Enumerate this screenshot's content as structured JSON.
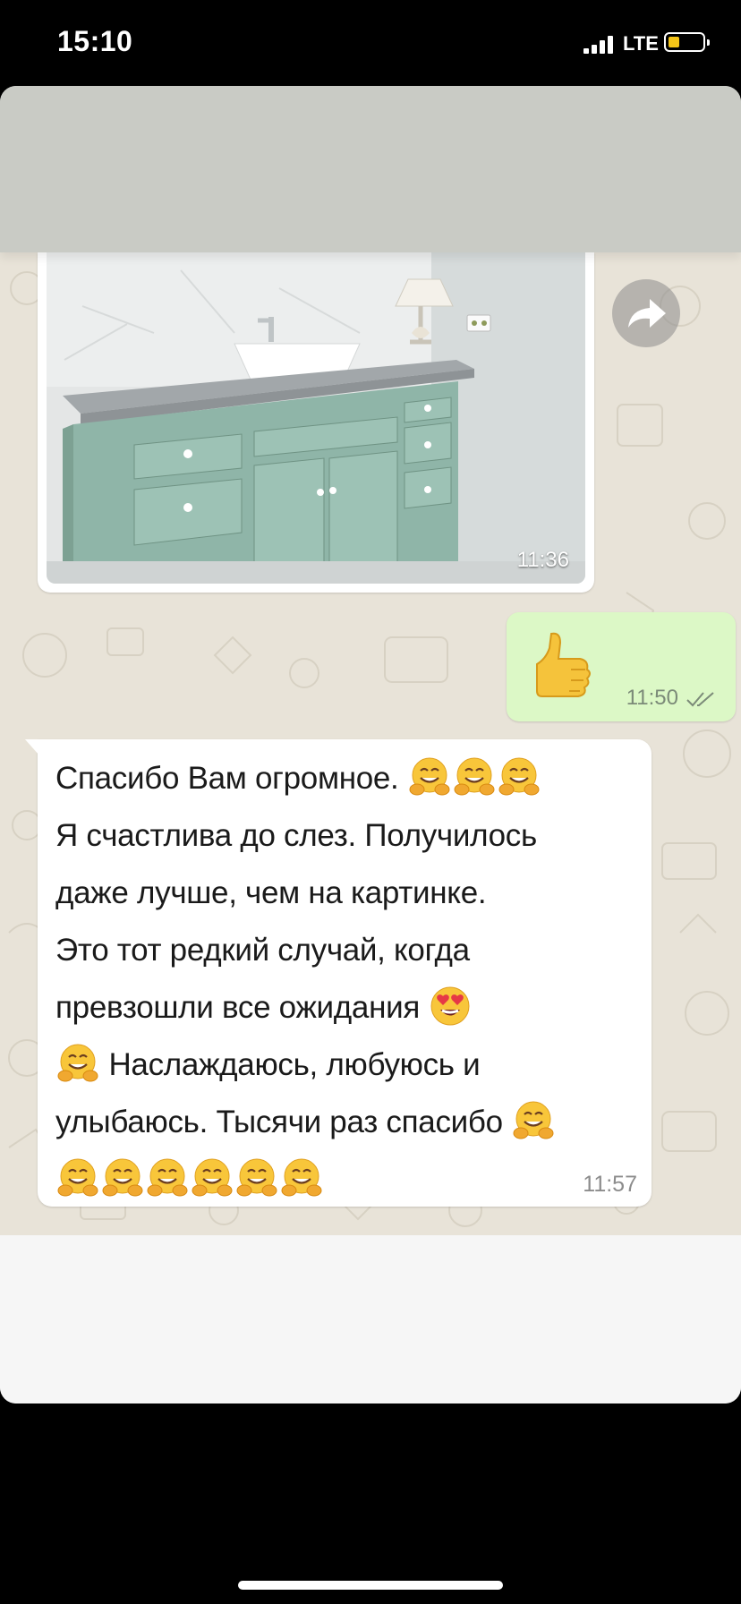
{
  "status_bar": {
    "time": "15:10",
    "network": "LTE"
  },
  "chat": {
    "image_message": {
      "time": "11:36"
    },
    "outgoing": {
      "emoji": "thumbs-up",
      "time": "11:50",
      "status": "read"
    },
    "incoming": {
      "lines": [
        "Спасибо Вам огромное.",
        "Я счастлива до слез. Получилось",
        "даже лучше, чем на картинке.",
        "Это тот редкий случай, когда",
        "превзошли все ожидания",
        "Наслаждаюсь, любуюсь и",
        "улыбаюсь. Тысячи раз спасибо"
      ],
      "time": "11:57"
    }
  },
  "colors": {
    "header": "#c9cbc5",
    "chat_bg": "#e8e3d8",
    "outgoing_bubble": "#dcf8c6",
    "incoming_bubble": "#ffffff",
    "tick": "#7b8a78",
    "cabinet": "#8fb5a8"
  }
}
